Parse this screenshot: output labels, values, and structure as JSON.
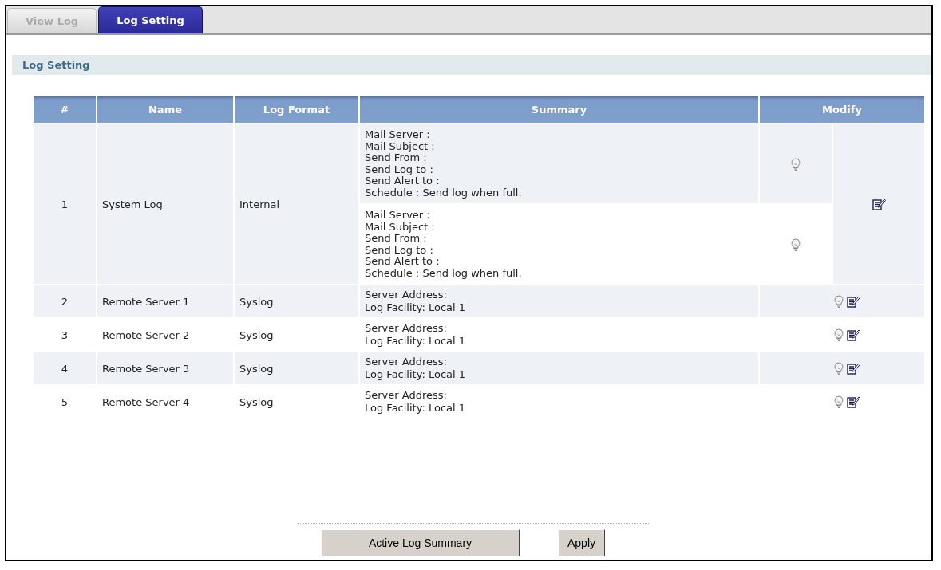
{
  "tabs": [
    {
      "label": "View Log",
      "selected": false
    },
    {
      "label": "Log Setting",
      "selected": true
    }
  ],
  "section": {
    "title": "Log Setting"
  },
  "table": {
    "columns": [
      "#",
      "Name",
      "Log Format",
      "Summary",
      "Modify"
    ],
    "rows": [
      {
        "number": "1",
        "name": "System Log",
        "log_format": "Internal",
        "summaries": [
          [
            "Mail Server :",
            "Mail Subject :",
            "Send From :",
            "Send Log to :",
            "Send Alert to :",
            "Schedule : Send log when full."
          ],
          [
            "Mail Server :",
            "Mail Subject :",
            "Send From :",
            "Send Log to :",
            "Send Alert to :",
            "Schedule : Send log when full."
          ]
        ]
      },
      {
        "number": "2",
        "name": "Remote Server 1",
        "log_format": "Syslog",
        "summaries": [
          [
            "Server Address:",
            "Log Facility: Local 1"
          ]
        ]
      },
      {
        "number": "3",
        "name": "Remote Server 2",
        "log_format": "Syslog",
        "summaries": [
          [
            "Server Address:",
            "Log Facility: Local 1"
          ]
        ]
      },
      {
        "number": "4",
        "name": "Remote Server 3",
        "log_format": "Syslog",
        "summaries": [
          [
            "Server Address:",
            "Log Facility: Local 1"
          ]
        ]
      },
      {
        "number": "5",
        "name": "Remote Server 4",
        "log_format": "Syslog",
        "summaries": [
          [
            "Server Address:",
            "Log Facility: Local 1"
          ]
        ]
      }
    ]
  },
  "buttons": [
    "Active Log Summary",
    "Apply"
  ]
}
